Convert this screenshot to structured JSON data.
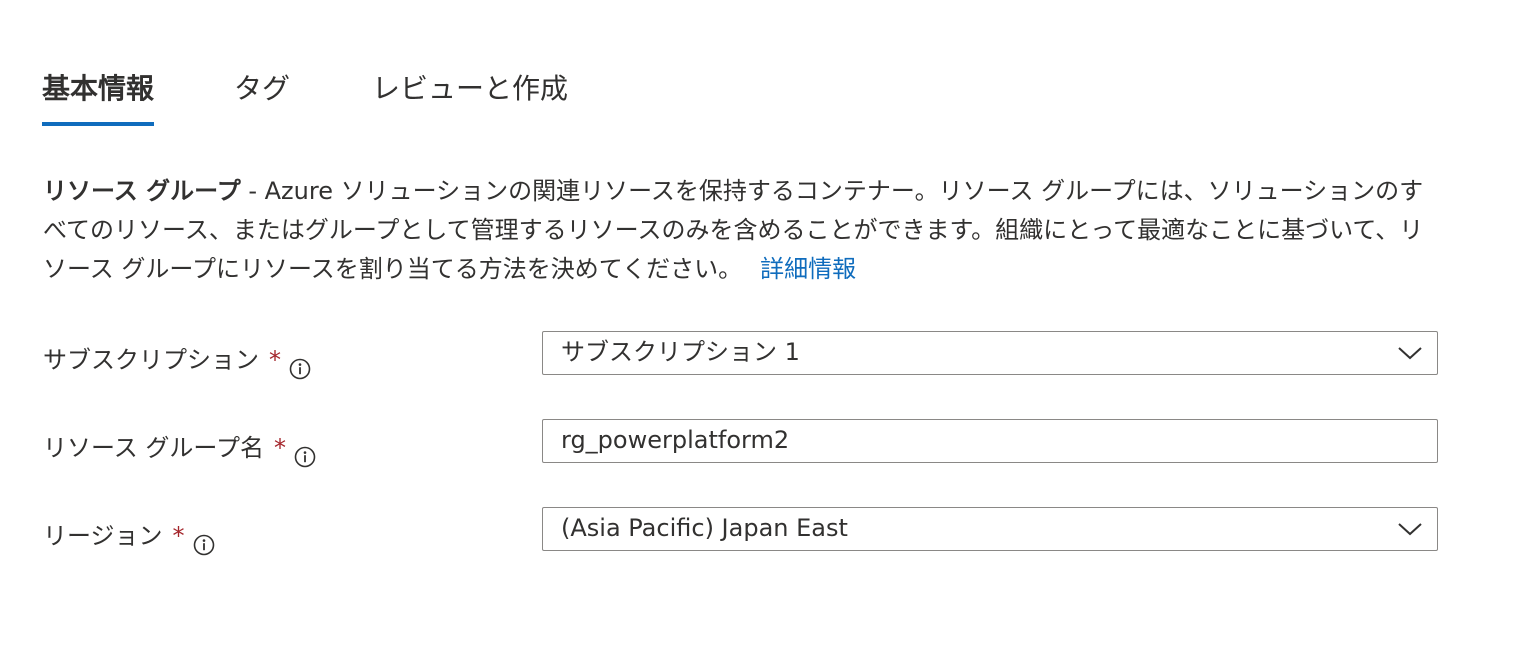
{
  "tabs": {
    "basics": "基本情報",
    "tags": "タグ",
    "review": "レビューと作成",
    "accent_color": "#0f6cbd"
  },
  "description": {
    "term": "リソース グループ",
    "line1_text": " - Azure ソリューションの関連リソースを保持するコンテナー。リソース グループには、ソリューションのすべてのリソース、またはグループとして管理するリソースのみを含めることができます。組織にとって最適なことに基づいて、リソース グループにリソースを割り当てる方法を決めてください。",
    "link": "詳細情報"
  },
  "fields": {
    "subscription": {
      "label": "サブスクリプション",
      "required": "*",
      "info_icon": "info-icon",
      "value": "サブスクリプション 1",
      "chevron_icon": "chevron-down-icon"
    },
    "resource_group": {
      "label": "リソース グループ名",
      "required": "*",
      "info_icon": "info-icon",
      "value": "rg_powerplatform2"
    },
    "region": {
      "label": "リージョン",
      "required": "*",
      "info_icon": "info-icon",
      "value": "(Asia Pacific) Japan East",
      "chevron_icon": "chevron-down-icon"
    }
  }
}
